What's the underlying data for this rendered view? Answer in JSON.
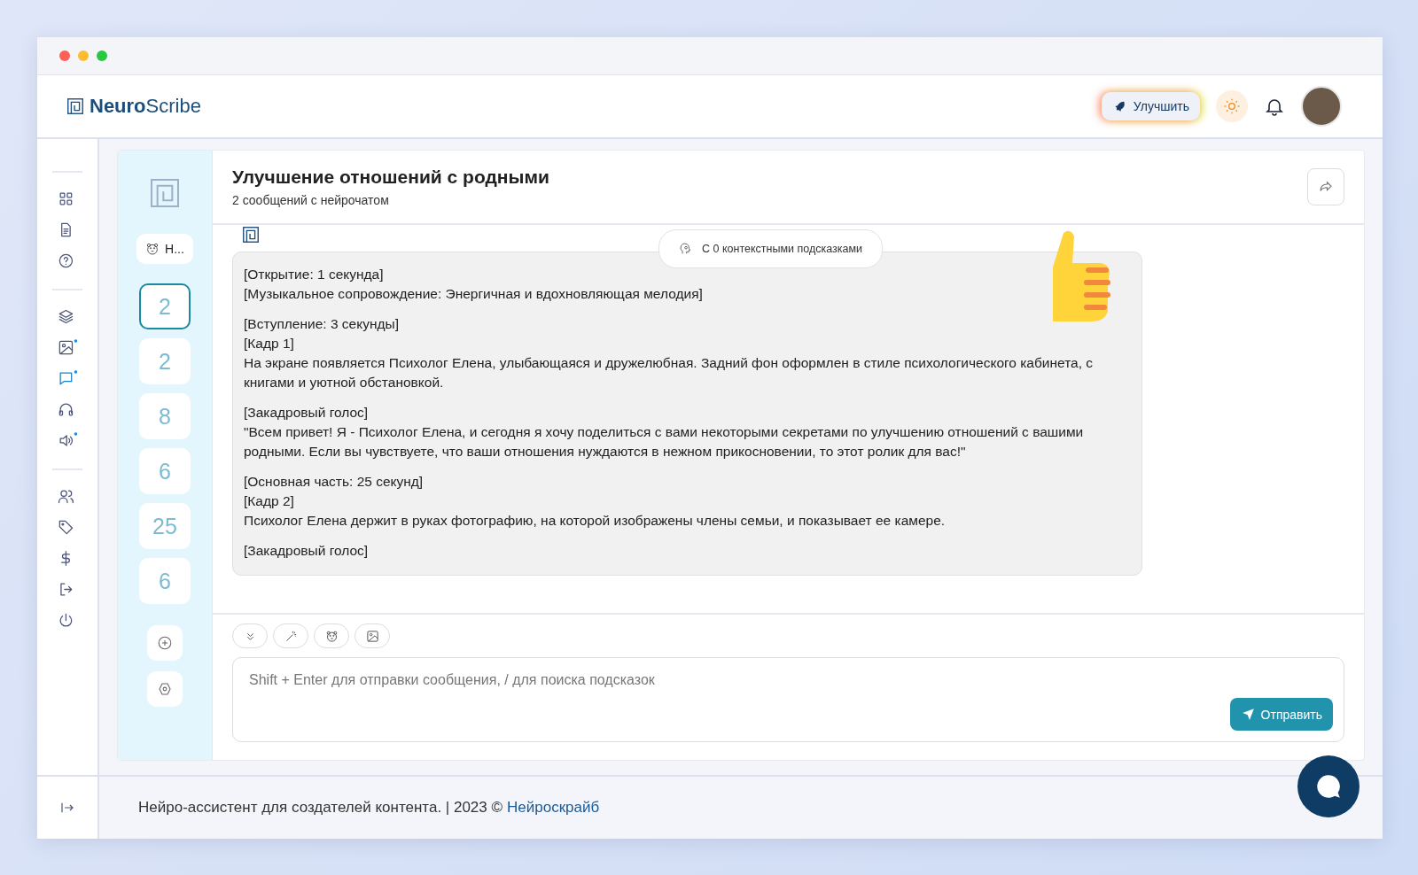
{
  "header": {
    "logo": "**Neuro**Scribe",
    "upgrade_button": "Улучшить"
  },
  "rail": {
    "groups": [
      {
        "items": [
          {
            "kind": "grid",
            "selected": false,
            "dot": false
          },
          {
            "kind": "document",
            "selected": false,
            "dot": false
          },
          {
            "kind": "help",
            "selected": false,
            "dot": false
          }
        ]
      },
      {
        "items": [
          {
            "kind": "layers",
            "selected": false,
            "dot": false
          },
          {
            "kind": "image",
            "selected": false,
            "dot": true
          },
          {
            "kind": "chat",
            "selected": true,
            "dot": true
          },
          {
            "kind": "headphones",
            "selected": false,
            "dot": false
          },
          {
            "kind": "speaker",
            "selected": false,
            "dot": true
          }
        ]
      },
      {
        "items": [
          {
            "kind": "users",
            "selected": false,
            "dot": false
          },
          {
            "kind": "tag",
            "selected": false,
            "dot": false
          },
          {
            "kind": "dollar",
            "selected": false,
            "dot": false
          },
          {
            "kind": "logout",
            "selected": false,
            "dot": false
          },
          {
            "kind": "power",
            "selected": false,
            "dot": false
          }
        ]
      }
    ]
  },
  "conversations": {
    "assistant_chip": "Н...",
    "items": [
      {
        "label": "2",
        "selected": true
      },
      {
        "label": "2",
        "selected": false
      },
      {
        "label": "8",
        "selected": false
      },
      {
        "label": "6",
        "selected": false
      },
      {
        "label": "25",
        "selected": false
      },
      {
        "label": "6",
        "selected": false
      }
    ]
  },
  "chat": {
    "title": "Улучшение отношений с родными",
    "subtitle": "2 сообщений с нейрочатом",
    "context_hints": "С 0 контекстными подсказками",
    "message": [
      [
        "[Открытие: 1 секунда]",
        "[Музыкальное сопровождение: Энергичная и вдохновляющая мелодия]"
      ],
      [
        "[Вступление: 3 секунды]",
        "[Кадр 1]",
        "На экране появляется Психолог Елена, улыбающаяся и дружелюбная. Задний фон оформлен в стиле психологического кабинета, с книгами и уютной обстановкой."
      ],
      [
        "[Закадровый голос]",
        "\"Всем привет! Я - Психолог Елена, и сегодня я хочу поделиться с вами некоторыми секретами по улучшению отношений с вашими родными. Если вы чувствуете, что ваши отношения нуждаются в нежном прикосновении, то этот ролик для вас!\""
      ],
      [
        "[Основная часть: 25 секунд]",
        "[Кадр 2]",
        "Психолог Елена держит в руках фотографию, на которой изображены члены семьи, и показывает ее камере."
      ],
      [
        "[Закадровый голос]"
      ]
    ]
  },
  "composer": {
    "tools": [
      {
        "kind": "chevrons"
      },
      {
        "kind": "wand"
      },
      {
        "kind": "bear"
      },
      {
        "kind": "image"
      }
    ],
    "placeholder": "Shift + Enter для отправки сообщения, / для поиска подсказок",
    "send_button": "Отправить"
  },
  "footer": {
    "text": "Нейро-ассистент для создателей контента.  | 2023 ©",
    "link": "Нейроскрайб"
  }
}
